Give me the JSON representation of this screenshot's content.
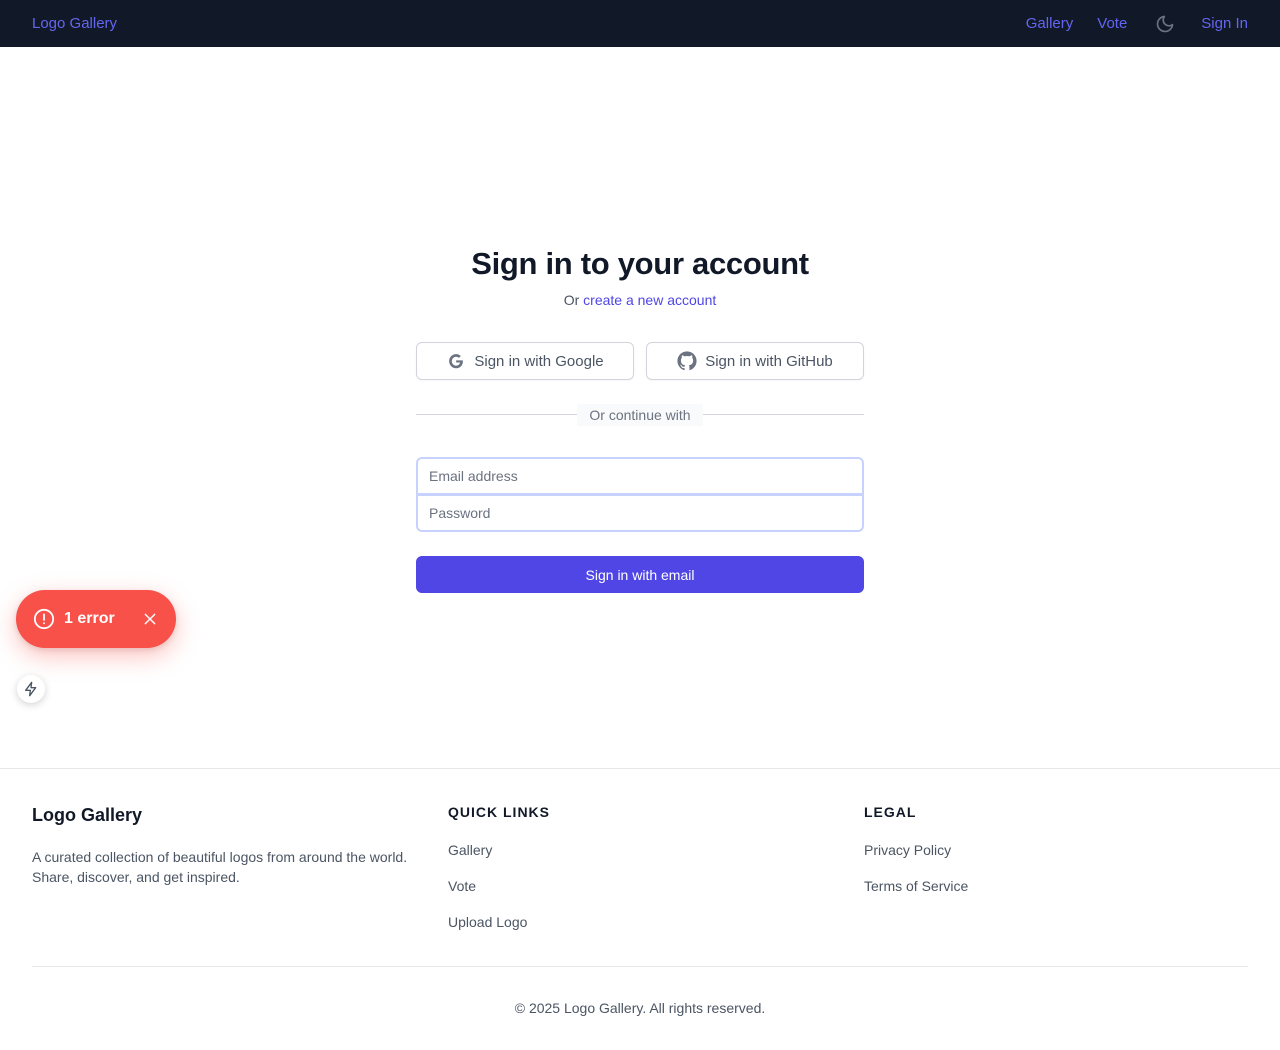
{
  "nav": {
    "brand": "Logo Gallery",
    "links": [
      "Gallery",
      "Vote"
    ],
    "theme_icon": "moon-icon",
    "signin": "Sign In"
  },
  "signin": {
    "title": "Sign in to your account",
    "or_text": "Or",
    "create_link": "create a new account",
    "google_label": "Sign in with Google",
    "github_label": "Sign in with GitHub",
    "divider": "Or continue with",
    "email_placeholder": "Email address",
    "email_value": "",
    "password_placeholder": "Password",
    "password_value": "",
    "submit_label": "Sign in with email"
  },
  "dev_overlay": {
    "error_label": "1 error",
    "error_icon": "alert-circle-icon",
    "close_icon": "close-icon",
    "bolt_icon": "bolt-icon"
  },
  "footer": {
    "brand": "Logo Gallery",
    "description": "A curated collection of beautiful logos from around the world. Share, discover, and get inspired.",
    "quick_links_title": "QUICK LINKS",
    "quick_links": [
      "Gallery",
      "Vote",
      "Upload Logo"
    ],
    "legal_title": "LEGAL",
    "legal_links": [
      "Privacy Policy",
      "Terms of Service"
    ],
    "copyright": "© 2025 Logo Gallery. All rights reserved."
  },
  "colors": {
    "nav_bg": "#111827",
    "accent": "#4f46e5",
    "nav_link": "#6366f1",
    "error": "#f85149",
    "input_border": "#c7d2fe"
  }
}
